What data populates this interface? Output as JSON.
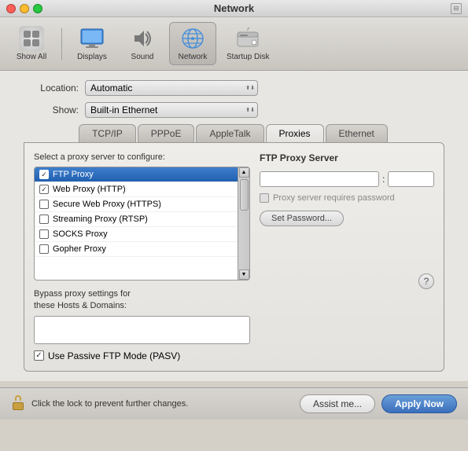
{
  "window": {
    "title": "Network"
  },
  "toolbar": {
    "items": [
      {
        "id": "show-all",
        "label": "Show All",
        "icon": "grid"
      },
      {
        "id": "displays",
        "label": "Displays",
        "icon": "display"
      },
      {
        "id": "sound",
        "label": "Sound",
        "icon": "speaker"
      },
      {
        "id": "network",
        "label": "Network",
        "icon": "network",
        "active": true
      },
      {
        "id": "startup-disk",
        "label": "Startup Disk",
        "icon": "disk"
      }
    ]
  },
  "location": {
    "label": "Location:",
    "value": "Automatic"
  },
  "show": {
    "label": "Show:",
    "value": "Built-in Ethernet"
  },
  "tabs": [
    {
      "id": "tcpip",
      "label": "TCP/IP"
    },
    {
      "id": "pppoe",
      "label": "PPPoE"
    },
    {
      "id": "appletalk",
      "label": "AppleTalk"
    },
    {
      "id": "proxies",
      "label": "Proxies",
      "active": true
    },
    {
      "id": "ethernet",
      "label": "Ethernet"
    }
  ],
  "proxies": {
    "section_title": "Select a proxy server to configure:",
    "items": [
      {
        "id": "ftp",
        "label": "FTP Proxy",
        "checked": true,
        "selected": true
      },
      {
        "id": "http",
        "label": "Web Proxy (HTTP)",
        "checked": true,
        "selected": false
      },
      {
        "id": "https",
        "label": "Secure Web Proxy (HTTPS)",
        "checked": false,
        "selected": false
      },
      {
        "id": "rtsp",
        "label": "Streaming Proxy (RTSP)",
        "checked": false,
        "selected": false
      },
      {
        "id": "socks",
        "label": "SOCKS Proxy",
        "checked": false,
        "selected": false
      },
      {
        "id": "gopher",
        "label": "Gopher Proxy",
        "checked": false,
        "selected": false
      }
    ],
    "bypass_label": "Bypass proxy settings for\nthese Hosts & Domains:",
    "bypass_value": "",
    "passive_ftp_label": "Use Passive FTP Mode (PASV)",
    "passive_ftp_checked": true
  },
  "ftp_proxy": {
    "title": "FTP Proxy Server",
    "server_value": "",
    "port_value": "",
    "requires_password_label": "Proxy server requires password",
    "set_password_label": "Set Password..."
  },
  "bottom_bar": {
    "lock_text": "Click the lock to prevent further changes.",
    "assist_label": "Assist me...",
    "apply_label": "Apply Now"
  }
}
